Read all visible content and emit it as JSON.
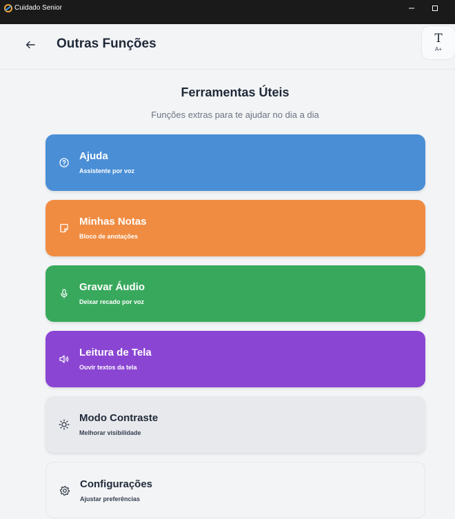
{
  "window": {
    "title": "Cuidado Senior"
  },
  "header": {
    "title": "Outras Funções",
    "font_icon_big": "T",
    "font_icon_small": "A+"
  },
  "main": {
    "title": "Ferramentas Úteis",
    "subtitle": "Funções extras para te ajudar no dia a dia"
  },
  "cards": [
    {
      "label": "Ajuda",
      "sub": "Assistente por voz",
      "icon": "help-circle-icon",
      "color": "#4a8ed6"
    },
    {
      "label": "Minhas Notas",
      "sub": "Bloco de anotações",
      "icon": "note-icon",
      "color": "#f08c42"
    },
    {
      "label": "Gravar Áudio",
      "sub": "Deixar recado por voz",
      "icon": "microphone-icon",
      "color": "#38a95c"
    },
    {
      "label": "Leitura de Tela",
      "sub": "Ouvir textos da tela",
      "icon": "speaker-icon",
      "color": "#8a45d3"
    },
    {
      "label": "Modo Contraste",
      "sub": "Melhorar visibilidade",
      "icon": "sun-icon",
      "color": "#e8e9ed"
    },
    {
      "label": "Configurações",
      "sub": "Ajustar preferências",
      "icon": "gear-icon",
      "color": "#f3f4f6"
    }
  ]
}
